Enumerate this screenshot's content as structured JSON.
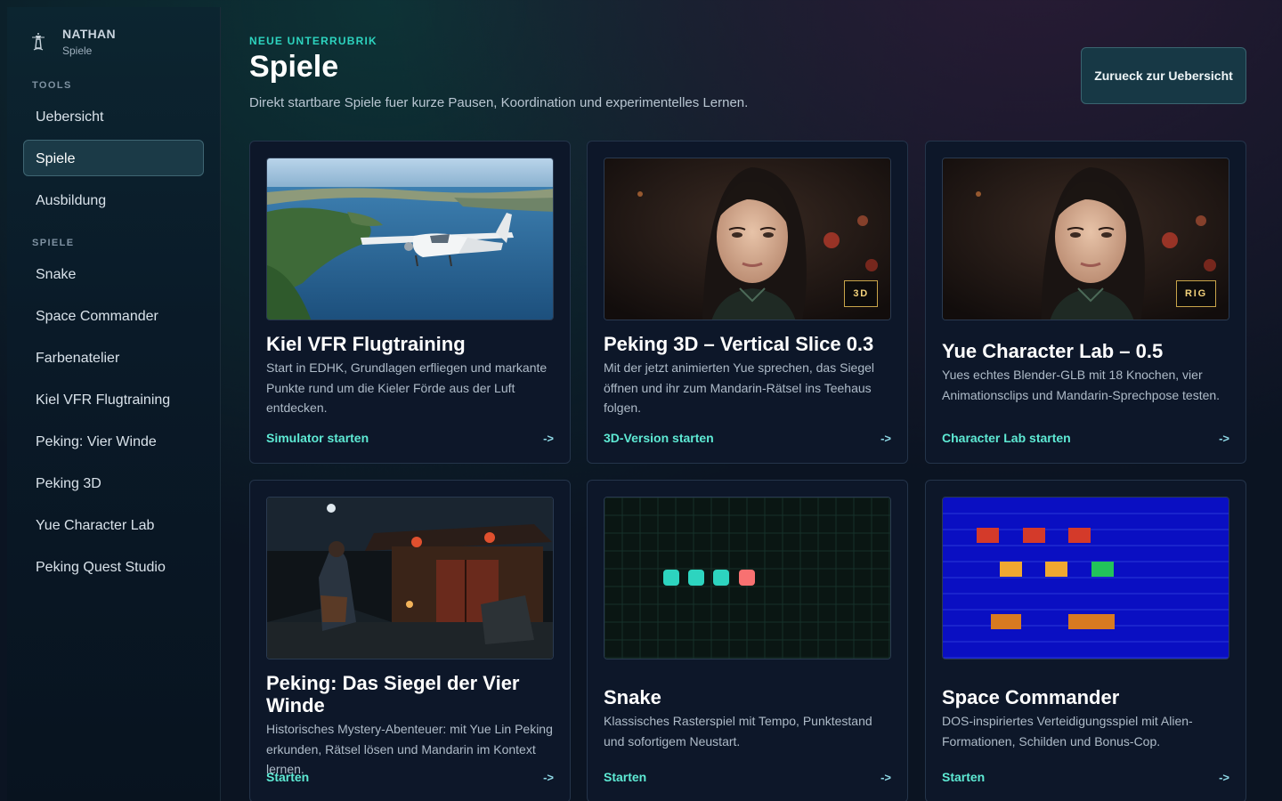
{
  "brand": {
    "name": "NATHAN",
    "sub": "Spiele",
    "logo_icon": "lighthouse-icon"
  },
  "sidebar": {
    "sections": [
      {
        "label": "TOOLS",
        "items": [
          {
            "label": "Uebersicht",
            "active": false
          },
          {
            "label": "Spiele",
            "active": true
          },
          {
            "label": "Ausbildung",
            "active": false
          }
        ]
      },
      {
        "label": "SPIELE",
        "items": [
          {
            "label": "Snake",
            "active": false
          },
          {
            "label": "Space Commander",
            "active": false
          },
          {
            "label": "Farbenatelier",
            "active": false
          },
          {
            "label": "Kiel VFR Flugtraining",
            "active": false
          },
          {
            "label": "Peking: Vier Winde",
            "active": false
          },
          {
            "label": "Peking 3D",
            "active": false
          },
          {
            "label": "Yue Character Lab",
            "active": false
          },
          {
            "label": "Peking Quest Studio",
            "active": false
          }
        ]
      }
    ]
  },
  "header": {
    "eyebrow": "NEUE UNTERRUBRIK",
    "title": "Spiele",
    "description": "Direkt startbare Spiele fuer kurze Pausen, Koordination und experimentelles Lernen.",
    "back_button": "Zurueck zur Uebersicht"
  },
  "cards": [
    {
      "title": "Kiel VFR Flugtraining",
      "description": "Start in EDHK, Grundlagen erfliegen und markante Punkte rund um die Kieler Förde aus der Luft entdecken.",
      "link": "Simulator starten",
      "arrow": "->",
      "badge": "",
      "image": "aerial-plane-image"
    },
    {
      "title": "Peking 3D – Vertical Slice 0.3",
      "description": "Mit der jetzt animierten Yue sprechen, das Siegel öffnen und ihr zum Mandarin-Rätsel ins Teehaus folgen.",
      "link": "3D-Version starten",
      "arrow": "->",
      "badge": "3D",
      "image": "portrait-image"
    },
    {
      "title": "Yue Character Lab – 0.5",
      "description": "Yues echtes Blender-GLB mit 18 Knochen, vier Animationsclips und Mandarin-Sprechpose testen.",
      "link": "Character Lab starten",
      "arrow": "->",
      "badge": "RIG",
      "image": "portrait-image"
    },
    {
      "title": "Peking: Das Siegel der Vier Winde",
      "description": "Historisches Mystery-Abenteuer: mit Yue Lin Peking erkunden, Rätsel lösen und Mandarin im Kontext lernen.",
      "link": "Starten",
      "arrow": "->",
      "badge": "",
      "image": "night-courtyard-image"
    },
    {
      "title": "Snake",
      "description": "Klassisches Rasterspiel mit Tempo, Punktestand und sofortigem Neustart.",
      "link": "Starten",
      "arrow": "->",
      "badge": "",
      "image": "snake-grid-image"
    },
    {
      "title": "Space Commander",
      "description": "DOS-inspiriertes Verteidigungsspiel mit Alien-Formationen, Schilden und Bonus-Cop.",
      "link": "Starten",
      "arrow": "->",
      "badge": "",
      "image": "space-invaders-image"
    }
  ],
  "colors": {
    "accent": "#2dd4bf",
    "link": "#5eead4",
    "badge": "#f3d27a",
    "active_nav": "#1b3a47"
  }
}
